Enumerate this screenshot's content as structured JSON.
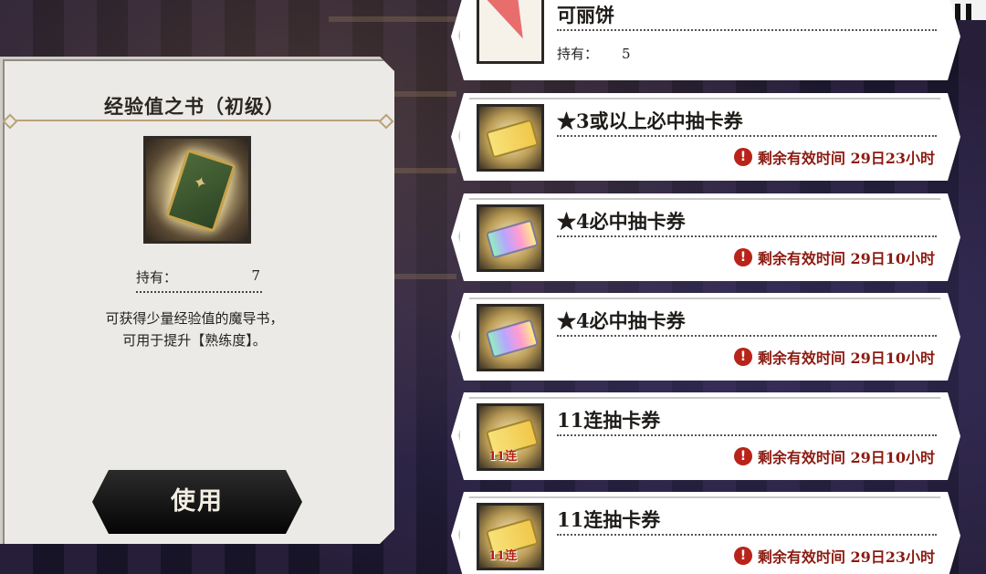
{
  "detail": {
    "title": "经验值之书（初级）",
    "holding_label": "持有：",
    "holding_value": "7",
    "description_line1": "可获得少量经验值的魔导书，",
    "description_line2": "可用于提升【熟练度】。",
    "use_button": "使用"
  },
  "items": [
    {
      "name": "可丽饼",
      "holding_label": "持有：",
      "holding_value": "5",
      "icon": "crepe-icon"
    },
    {
      "name": "★3或以上必中抽卡券",
      "expiry": "剩余有效时间 29日23小时",
      "icon": "gold-ticket-icon"
    },
    {
      "name": "★4必中抽卡券",
      "expiry": "剩余有效时间 29日10小时",
      "icon": "rainbow-ticket-icon"
    },
    {
      "name": "★4必中抽卡券",
      "expiry": "剩余有效时间 29日10小时",
      "icon": "rainbow-ticket-icon"
    },
    {
      "name": "11连抽卡券",
      "expiry": "剩余有效时间 29日10小时",
      "icon": "eleven-draw-ticket-icon",
      "tag": "11连"
    },
    {
      "name": "11连抽卡券",
      "expiry": "剩余有效时间 29日23小时",
      "icon": "eleven-draw-ticket-icon",
      "tag": "11连"
    }
  ],
  "colors": {
    "panel": "#eceae6",
    "accent_gold": "#b9a27a",
    "expiry_red": "#8b1a10",
    "button_dark": "#050505"
  }
}
